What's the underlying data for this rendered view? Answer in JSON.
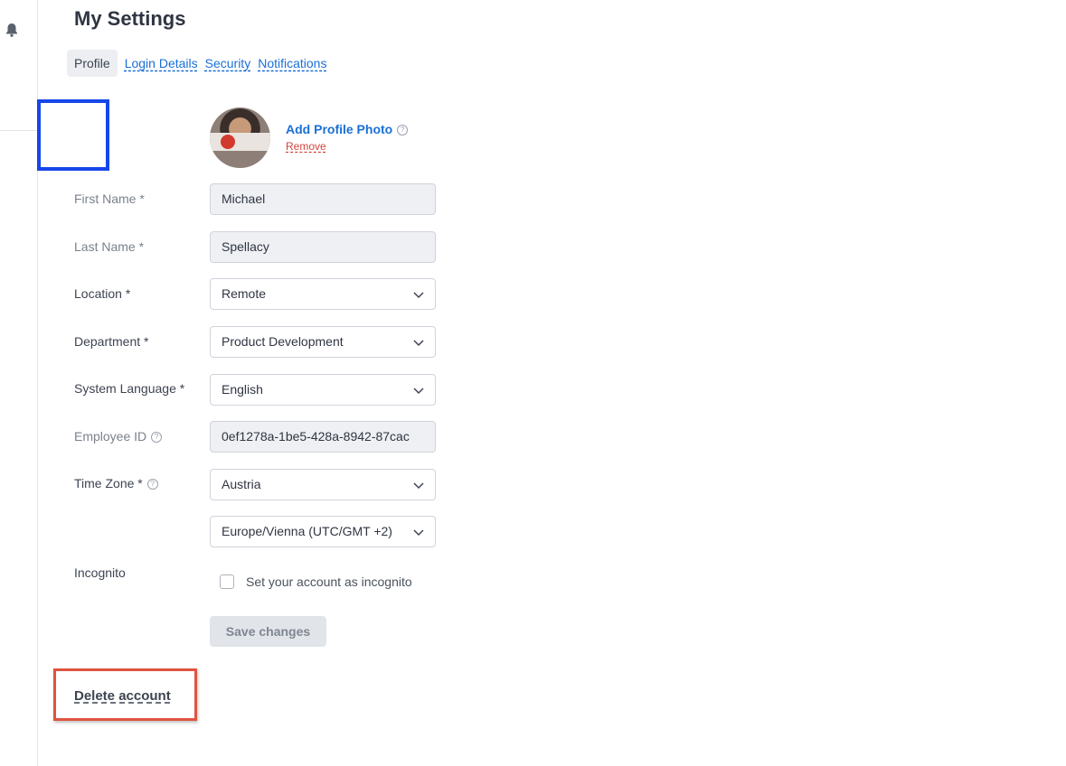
{
  "page": {
    "title": "My Settings"
  },
  "tabs": [
    {
      "label": "Profile",
      "active": true
    },
    {
      "label": "Login Details",
      "active": false
    },
    {
      "label": "Security",
      "active": false
    },
    {
      "label": "Notifications",
      "active": false
    }
  ],
  "profile_photo": {
    "add_label": "Add Profile Photo",
    "help_icon": "?",
    "remove_label": "Remove"
  },
  "form": {
    "first_name": {
      "label": "First Name *",
      "value": "Michael"
    },
    "last_name": {
      "label": "Last Name *",
      "value": "Spellacy"
    },
    "location": {
      "label": "Location *",
      "value": "Remote"
    },
    "department": {
      "label": "Department *",
      "value": "Product Development"
    },
    "system_language": {
      "label": "System Language *",
      "value": "English"
    },
    "employee_id": {
      "label": "Employee ID",
      "value": "0ef1278a-1be5-428a-8942-87cac"
    },
    "time_zone": {
      "label": "Time Zone *",
      "country": "Austria",
      "zone": "Europe/Vienna (UTC/GMT +2)"
    },
    "incognito": {
      "label": "Incognito",
      "checkbox_label": "Set your account as incognito",
      "checked": false
    }
  },
  "actions": {
    "save_label": "Save changes",
    "delete_label": "Delete account"
  },
  "colors": {
    "link": "#1a6fd6",
    "remove": "#d0453b",
    "highlight_blue": "#1646e8",
    "highlight_red": "#e0533f"
  },
  "icons": {
    "notifications": "bell-icon",
    "dropdown": "chevron-down-icon",
    "help": "help-circle-icon"
  }
}
